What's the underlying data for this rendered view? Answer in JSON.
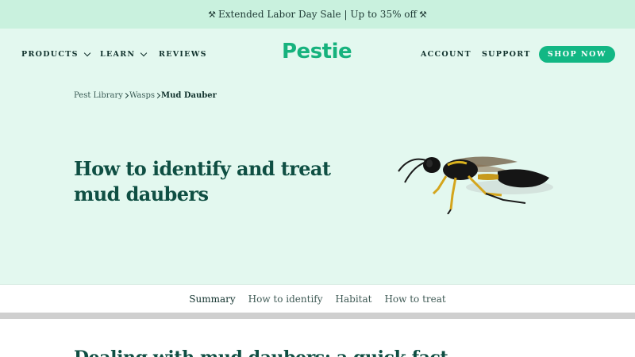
{
  "promo": {
    "icon": "hammer-icon",
    "text": "Extended Labor Day Sale | Up to 35% off"
  },
  "nav": {
    "left": [
      {
        "label": "PRODUCTS",
        "has_dropdown": true
      },
      {
        "label": "LEARN",
        "has_dropdown": true
      },
      {
        "label": "REVIEWS",
        "has_dropdown": false
      }
    ],
    "logo": "Pestie",
    "right": [
      {
        "label": "ACCOUNT"
      },
      {
        "label": "SUPPORT"
      }
    ],
    "cta": "SHOP NOW"
  },
  "breadcrumb": {
    "items": [
      "Pest Library",
      "Wasps"
    ],
    "current": "Mud Dauber"
  },
  "hero": {
    "title": "How to identify and treat mud daubers",
    "image": "mud-dauber-wasp-image"
  },
  "tabs": [
    {
      "label": "Summary",
      "active": true
    },
    {
      "label": "How to identify",
      "active": false
    },
    {
      "label": "Habitat",
      "active": false
    },
    {
      "label": "How to treat",
      "active": false
    }
  ],
  "section": {
    "heading": "Dealing with mud daubers: a quick fact"
  },
  "colors": {
    "brand": "#16b27d",
    "promo_bg": "#c9f1de",
    "hero_bg": "#e3f8ef",
    "heading": "#0f4f43"
  }
}
